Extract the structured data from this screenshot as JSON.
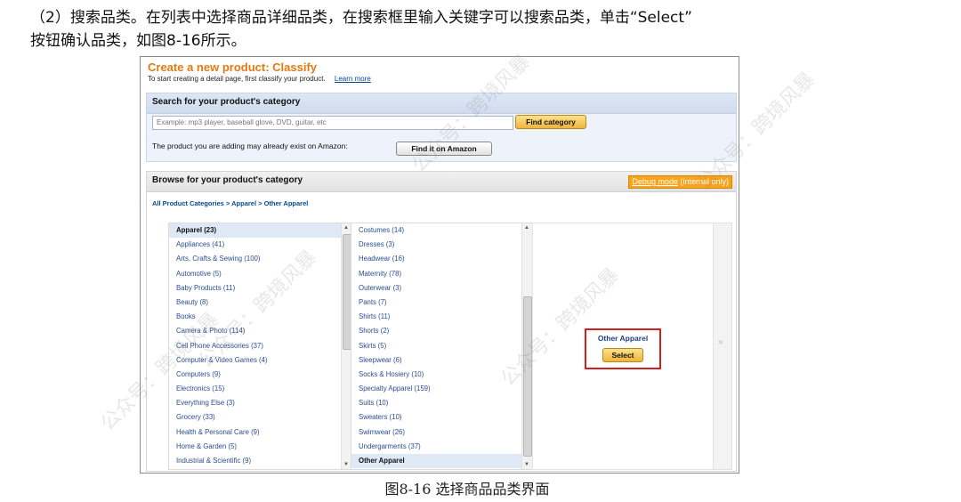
{
  "doc": {
    "para1": "（2）搜索品类。在列表中选择商品详细品类，在搜索框里输入关键字可以搜索品类，单击“Select”",
    "para2": "按钮确认品类，如图8-16所示。",
    "caption": "图8-16  选择商品品类界面"
  },
  "page": {
    "title": "Create a new product: Classify",
    "subtitle": "To start creating a detail page, first classify your product.",
    "learn_more": "Learn more"
  },
  "search": {
    "header": "Search for your product's category",
    "placeholder": "Example: mp3 player, baseball glove, DVD, guitar, etc",
    "find_category": "Find category",
    "exist_text": "The product you are adding may already exist on Amazon:",
    "find_it": "Find it on Amazon"
  },
  "browse": {
    "header": "Browse for your product's category",
    "debug_link": "Debug mode",
    "debug_suffix": " (internal only)",
    "breadcrumb": "All Product Categories > Apparel > Other Apparel"
  },
  "column1": [
    "Apparel (23)",
    "Appliances (41)",
    "Arts, Crafts & Sewing (100)",
    "Automotive (5)",
    "Baby Products (11)",
    "Beauty (8)",
    "Books",
    "Camera & Photo (114)",
    "Cell Phone Accessories (37)",
    "Computer & Video Games (4)",
    "Computers (9)",
    "Electronics (15)",
    "Everything Else (3)",
    "Grocery (33)",
    "Health & Personal Care (9)",
    "Home & Garden (5)",
    "Industrial & Scientific (9)"
  ],
  "column2": [
    "Costumes (14)",
    "Dresses (3)",
    "Headwear (16)",
    "Maternity (78)",
    "Outerwear (3)",
    "Pants (7)",
    "Shirts (11)",
    "Shorts (2)",
    "Skirts (5)",
    "Sleepwear (6)",
    "Socks & Hosiery (10)",
    "Specialty Apparel (159)",
    "Suits (10)",
    "Sweaters (10)",
    "Swimwear (26)",
    "Undergarments (37)",
    "Other Apparel"
  ],
  "result": {
    "label": "Other Apparel",
    "select": "Select"
  },
  "watermarks": [
    "公众号：跨境风暴",
    "公众号：跨境风暴",
    "公众号：跨境风暴",
    "公众号：跨境风暴",
    "公众号：跨境风暴"
  ],
  "colors": {
    "title_orange": "#e47911",
    "link_blue": "#2a4d8f",
    "highlight_red": "#d41f1f",
    "button_gold": "#f0b43c"
  }
}
